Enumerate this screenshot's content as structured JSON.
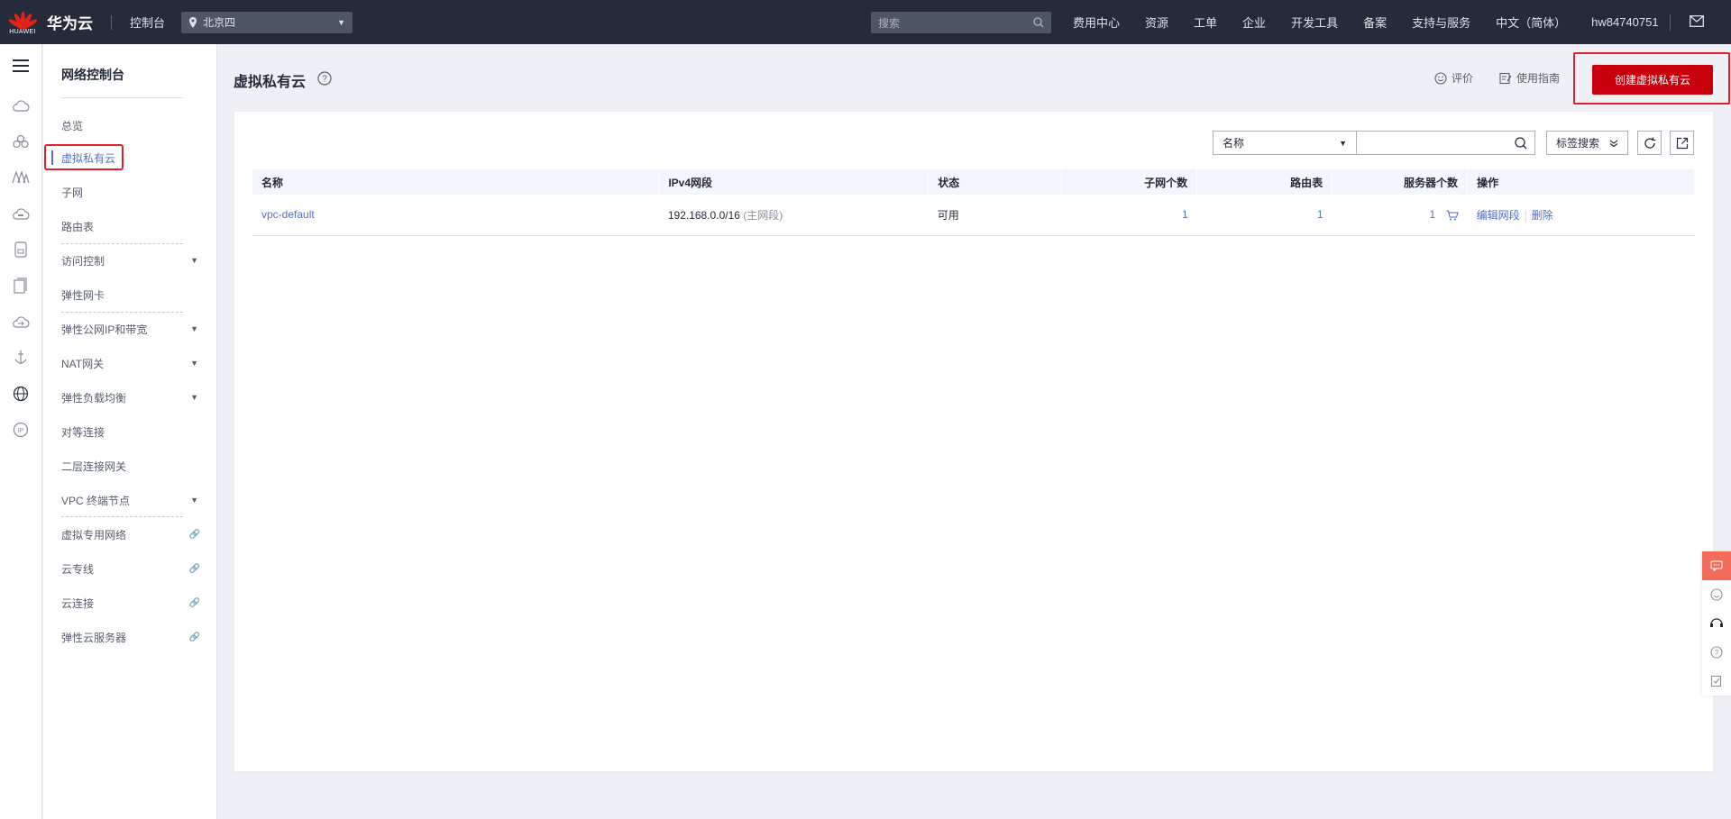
{
  "header": {
    "logo_word": "HUAWEI",
    "brand": "华为云",
    "console": "控制台",
    "region": "北京四",
    "search_placeholder": "搜索",
    "nav": [
      "费用中心",
      "资源",
      "工单",
      "企业",
      "开发工具",
      "备案",
      "支持与服务",
      "中文（简体）",
      "hw84740751"
    ]
  },
  "sidebar": {
    "title": "网络控制台",
    "items": [
      {
        "label": "总览"
      },
      {
        "label": "虚拟私有云"
      },
      {
        "label": "子网"
      },
      {
        "label": "路由表"
      },
      {
        "label": "访问控制"
      },
      {
        "label": "弹性网卡"
      },
      {
        "label": "弹性公网IP和带宽"
      },
      {
        "label": "NAT网关"
      },
      {
        "label": "弹性负载均衡"
      },
      {
        "label": "对等连接"
      },
      {
        "label": "二层连接网关"
      },
      {
        "label": "VPC 终端节点"
      },
      {
        "label": "虚拟专用网络"
      },
      {
        "label": "云专线"
      },
      {
        "label": "云连接"
      },
      {
        "label": "弹性云服务器"
      }
    ]
  },
  "page": {
    "title": "虚拟私有云",
    "rate": "评价",
    "guide": "使用指南",
    "create_button": "创建虚拟私有云"
  },
  "filters": {
    "field": "名称",
    "tag_search": "标签搜索"
  },
  "table": {
    "columns": [
      "名称",
      "IPv4网段",
      "状态",
      "子网个数",
      "路由表",
      "服务器个数",
      "操作"
    ],
    "rows": [
      {
        "name": "vpc-default",
        "cidr": "192.168.0.0/16",
        "cidr_note": "(主网段)",
        "status": "可用",
        "subnets": "1",
        "route_tables": "1",
        "servers": "1",
        "ops": [
          "编辑网段",
          "删除"
        ]
      }
    ]
  },
  "colors": {
    "topbar": "#252b3a",
    "primary_button": "#c7000b",
    "link": "#526ecc",
    "highlight": "#e3202a"
  }
}
